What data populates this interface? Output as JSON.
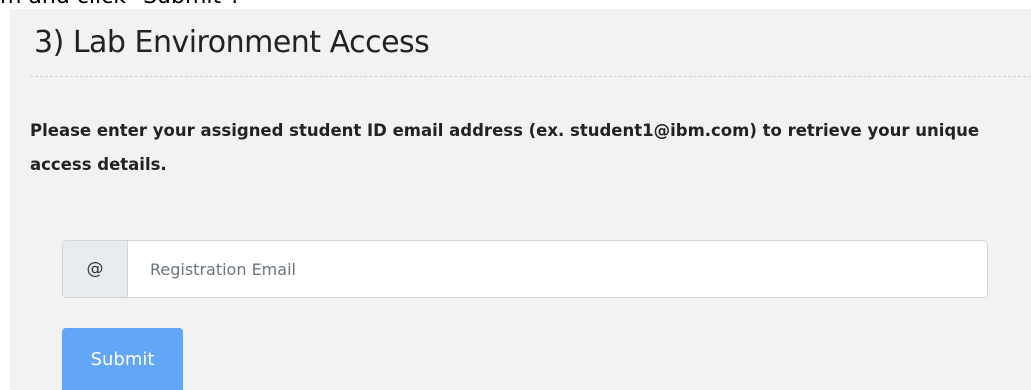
{
  "top_fragment": "m and click \"Submit\".",
  "section": {
    "heading": "3) Lab Environment Access",
    "instructions": "Please enter your assigned student ID email address (ex. student1@ibm.com) to retrieve your unique access details."
  },
  "form": {
    "addon_symbol": "@",
    "email_value": "",
    "email_placeholder": "Registration Email",
    "submit_label": "Submit"
  },
  "colors": {
    "panel_background": "#f2f2f2",
    "button_primary": "#62a6f7",
    "addon_background": "#e9ecef"
  }
}
